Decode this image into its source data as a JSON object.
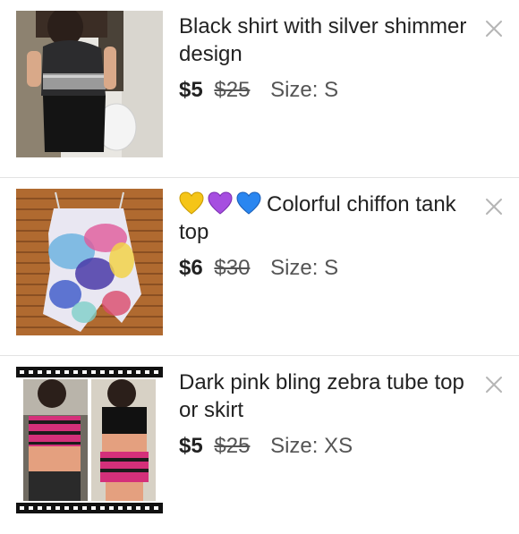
{
  "listings": [
    {
      "title": "Black shirt with silver shimmer design",
      "price": "$5",
      "original_price": "$25",
      "size": "Size: S",
      "emojis": []
    },
    {
      "title": "Colorful chiffon tank top",
      "price": "$6",
      "original_price": "$30",
      "size": "Size: S",
      "emojis": [
        "yellow-heart",
        "purple-heart",
        "blue-heart"
      ]
    },
    {
      "title": "Dark pink bling zebra tube top or skirt",
      "price": "$5",
      "original_price": "$25",
      "size": "Size: XS",
      "emojis": []
    }
  ],
  "icons": {
    "remove": "close-icon"
  },
  "colors": {
    "yellow_heart": "#f5c518",
    "purple_heart": "#a64ee0",
    "blue_heart": "#2a86f0",
    "divider": "#e3e3e3",
    "close_icon": "#b5b5b5"
  }
}
